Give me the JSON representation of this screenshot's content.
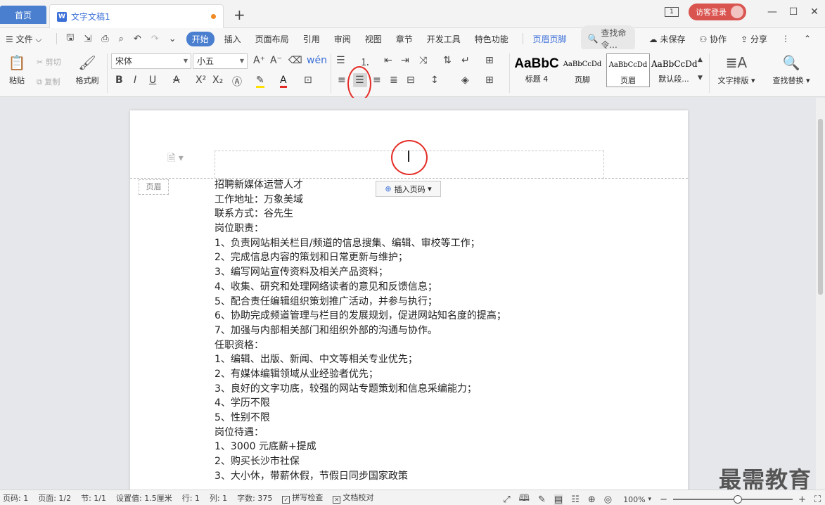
{
  "tabs": {
    "home": "首页",
    "doc_title": "文字文稿1",
    "add": "+"
  },
  "titlebar": {
    "page_indicator": "1",
    "login": "访客登录",
    "minimize": "—",
    "restore": "☐",
    "close": "✕"
  },
  "menu": {
    "file": "文件",
    "items": [
      "开始",
      "插入",
      "页面布局",
      "引用",
      "审阅",
      "视图",
      "章节",
      "开发工具",
      "特色功能"
    ],
    "contextual_tab": "页眉页脚",
    "search": "查找命令...",
    "unsaved": "未保存",
    "collaborate": "协作",
    "share": "分享"
  },
  "ribbon": {
    "paste": "粘贴",
    "cut": "剪切",
    "copy": "复制",
    "format_painter": "格式刷",
    "font_name": "宋体",
    "font_size": "小五",
    "styles": [
      {
        "sample": "AaBbC",
        "name": "标题 4"
      },
      {
        "sample": "AaBbCcDd",
        "name": "页脚"
      },
      {
        "sample": "AaBbCcDd",
        "name": "页眉"
      },
      {
        "sample": "AaBbCcDd",
        "name": "默认段..."
      }
    ],
    "text_layout": "文字排版",
    "find_replace": "查找替换"
  },
  "document": {
    "header_tag": "页眉",
    "insert_page_number": "插入页码",
    "lines": [
      "招聘新媒体运营人才",
      "工作地址：万象美域",
      "联系方式：谷先生",
      "岗位职责：",
      "1、负责网站相关栏目/频道的信息搜集、编辑、审校等工作；",
      "2、完成信息内容的策划和日常更新与维护；",
      "3、编写网站宣传资料及相关产品资料；",
      "4、收集、研究和处理网络读者的意见和反馈信息；",
      "5、配合责任编辑组织策划推广活动，并参与执行；",
      "6、协助完成频道管理与栏目的发展规划，促进网站知名度的提高；",
      "7、加强与内部相关部门和组织外部的沟通与协作。",
      "任职资格：",
      "1、编辑、出版、新闻、中文等相关专业优先；",
      "2、有媒体编辑领域从业经验者优先；",
      "3、良好的文字功底，较强的网站专题策划和信息采编能力；",
      "4、学历不限",
      "5、性别不限",
      "岗位待遇：",
      "1、3000 元底薪+提成",
      "2、购买长沙市社保",
      "3、大小休，带薪休假，节假日同步国家政策"
    ]
  },
  "watermark": "最需教育",
  "status": {
    "page_num": "页码: 1",
    "pages": "页面: 1/2",
    "section": "节: 1/1",
    "setting": "设置值: 1.5厘米",
    "row": "行: 1",
    "col": "列: 1",
    "word_count": "字数: 375",
    "spell_check": "拼写检查",
    "doc_proof": "文档校对",
    "zoom": "100%",
    "zoom_minus": "−",
    "zoom_plus": "+"
  },
  "colors": {
    "accent": "#4a7fd0",
    "annotation": "#e52d27",
    "login": "#d9534f"
  }
}
